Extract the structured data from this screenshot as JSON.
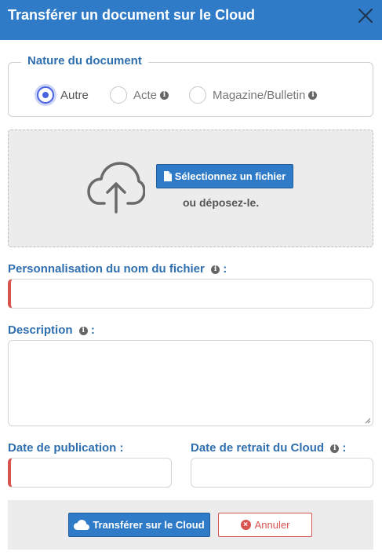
{
  "header": {
    "title": "Transférer un document sur le Cloud"
  },
  "nature": {
    "legend": "Nature du document",
    "options": [
      {
        "label": "Autre",
        "checked": true
      },
      {
        "label": "Acte",
        "checked": false
      },
      {
        "label": "Magazine/Bulletin",
        "checked": false
      }
    ]
  },
  "upload": {
    "select_label": "Sélectionnez un fichier",
    "drop_text": "ou déposez-le."
  },
  "form": {
    "filename_label": "Personnalisation du nom du fichier",
    "description_label": "Description",
    "colon": ":",
    "publication_label": "Date de publication :",
    "withdrawal_label": "Date de retrait du Cloud"
  },
  "footer": {
    "upload_label": "Transférer sur le Cloud",
    "cancel_label": "Annuler"
  },
  "colors": {
    "primary": "#2f7bc8",
    "label": "#2f6fb0",
    "danger": "#d9534f",
    "radio_active": "#4a63e0"
  }
}
